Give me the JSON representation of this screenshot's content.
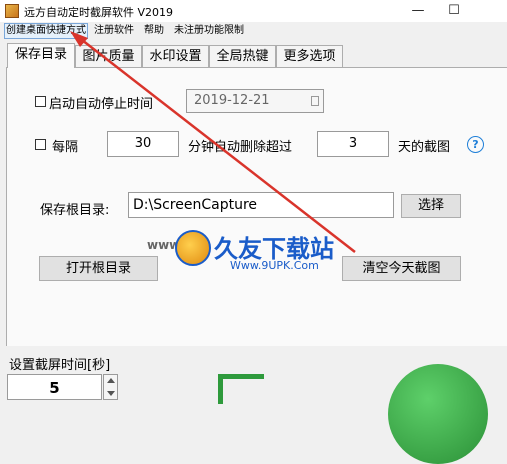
{
  "window": {
    "title": "远方自动定时截屏软件 V2019",
    "minimize_glyph": "—",
    "maximize_glyph": "☐"
  },
  "menu": {
    "items": [
      "创建桌面快捷方式",
      "注册软件",
      "帮助",
      "未注册功能限制"
    ]
  },
  "tabs": [
    "保存目录",
    "图片质量",
    "水印设置",
    "全局热键",
    "更多选项"
  ],
  "auto_stop": {
    "label": "启动自动停止时间",
    "date_value": "2019-12-21"
  },
  "auto_delete": {
    "label_every": "每隔",
    "minutes_value": "30",
    "label_middle": "分钟自动删除超过",
    "days_value": "3",
    "label_end": "天的截图",
    "help_glyph": "?"
  },
  "save_root": {
    "label": "保存根目录:",
    "path_value": "D:\\ScreenCapture",
    "choose_button": "选择"
  },
  "open_root_button": "打开根目录",
  "clear_today_button": "清空今天截图",
  "interval": {
    "label": "设置截屏时间[秒]",
    "value": "5"
  },
  "watermark": {
    "small": "www.9",
    "brand": "久友下载站",
    "url": "Www.9UPK.Com"
  },
  "colors": {
    "arrow": "#d9342b",
    "brand_blue": "#1a5cc9",
    "green": "#2e9a3c"
  }
}
